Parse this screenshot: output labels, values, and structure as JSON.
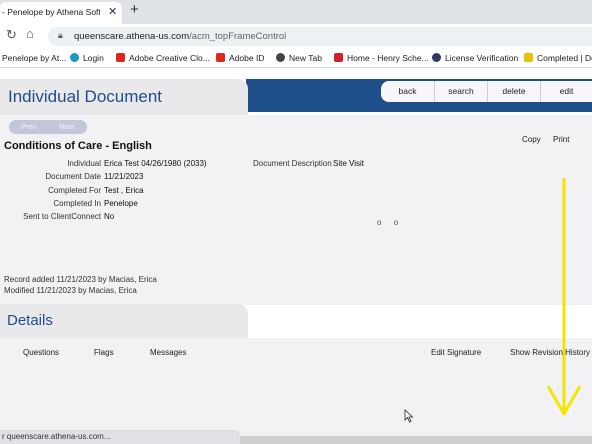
{
  "browser": {
    "tab_title": "- Penelope by Athena Softwa",
    "url_domain": "queenscare.athena-us.com",
    "url_path": "/acm_topFrameControl",
    "bookmarks": [
      {
        "label": "Penelope by At...",
        "icon": "penelope-icon",
        "color": "#1f4f8b"
      },
      {
        "label": "Login",
        "icon": "salesforce-cloud-icon",
        "color": "#1798c1"
      },
      {
        "label": "Adobe Creative Clo...",
        "icon": "adobe-icon",
        "color": "#e1251b"
      },
      {
        "label": "Adobe ID",
        "icon": "adobe-icon",
        "color": "#e1251b"
      },
      {
        "label": "New Tab",
        "icon": "globe-icon",
        "color": "#444444"
      },
      {
        "label": "Home - Henry Sche...",
        "icon": "henry-schein-icon",
        "color": "#d12229"
      },
      {
        "label": "License Verification",
        "icon": "seal-icon",
        "color": "#2b3a67"
      },
      {
        "label": "Completed | Do",
        "icon": "download-icon",
        "color": "#e5c20a"
      }
    ],
    "status_url": "r queenscare.athena-us.com..."
  },
  "app": {
    "page_title": "Individual Document",
    "actions": [
      "back",
      "search",
      "delete",
      "edit"
    ],
    "pager": {
      "prev": "Prev",
      "next": "Next"
    },
    "doc_title": "Conditions of Care - English",
    "copy_label": "Copy",
    "print_label": "Print",
    "fields": [
      {
        "label": "Individual",
        "value": "Erica  Test  04/26/1980 (2033)"
      },
      {
        "label": "Document Date",
        "value": "11/21/2023"
      },
      {
        "label": "Completed For",
        "value": "Test , Erica"
      },
      {
        "label": "Completed In",
        "value": "Penelope"
      },
      {
        "label": "Sent to ClientConnect",
        "value": "No"
      }
    ],
    "description": {
      "label": "Document Description",
      "value": "Site Visit"
    },
    "indicator": "o o",
    "record_added": "Record added 11/21/2023 by Macias, Erica",
    "modified": "Modified 11/21/2023 by Macias, Erica",
    "details_title": "Details",
    "detail_tabs": [
      "Questions",
      "Flags",
      "Messages",
      "Edit Signature",
      "Show Revision History"
    ]
  },
  "colors": {
    "brand_blue": "#1f4f8b",
    "panel_gray": "#e9e8ea",
    "annotation_yellow": "#f2e600"
  }
}
